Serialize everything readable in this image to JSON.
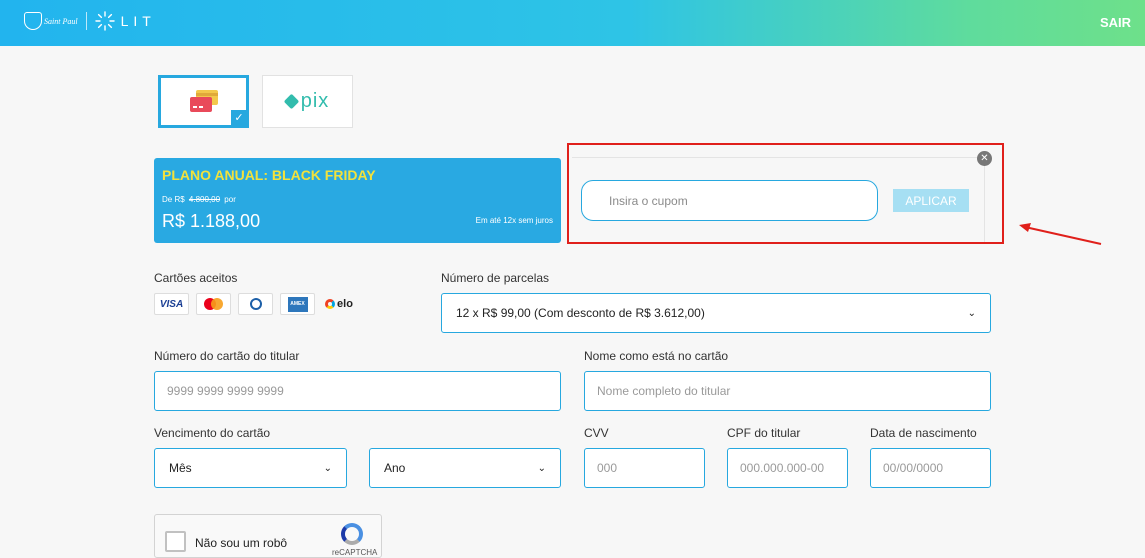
{
  "header": {
    "brand_saintpaul": "Saint Paul",
    "brand_lit": "LIT",
    "logout_label": "SAIR"
  },
  "payment_methods": {
    "card_selected": true,
    "pix_label": "pix"
  },
  "plan": {
    "title": "PLANO ANUAL: BLACK FRIDAY",
    "from_prefix": "De R$",
    "old_price": "4.800,00",
    "from_suffix": "por",
    "price": "R$ 1.188,00",
    "installment_note": "Em até 12x sem juros"
  },
  "coupon": {
    "placeholder": "Insira o cupom",
    "value": "",
    "apply_label": "APLICAR",
    "highlight_color": "#e0201b"
  },
  "form": {
    "accepted_cards_label": "Cartões aceitos",
    "accepted_cards": [
      "VISA",
      "mastercard",
      "Diners Club",
      "American Express",
      "elo"
    ],
    "installments_label": "Número de parcelas",
    "installments_value": "12 x R$ 99,00 (Com desconto de R$ 3.612,00)",
    "card_number_label": "Número do cartão do titular",
    "card_number_placeholder": "9999 9999 9999 9999",
    "holder_name_label": "Nome como está no cartão",
    "holder_name_placeholder": "Nome completo do titular",
    "expiry_label": "Vencimento do cartão",
    "month_value": "Mês",
    "year_value": "Ano",
    "cvv_label": "CVV",
    "cvv_placeholder": "000",
    "cpf_label": "CPF do titular",
    "cpf_placeholder": "000.000.000-00",
    "birth_label": "Data de nascimento",
    "birth_placeholder": "00/00/0000"
  },
  "recaptcha": {
    "label": "Não sou um robô",
    "brand": "reCAPTCHA"
  },
  "colors": {
    "accent": "#27a8df",
    "plan_bg": "#29a9e2",
    "plan_title": "#f2e23c",
    "pix": "#32bcad"
  }
}
